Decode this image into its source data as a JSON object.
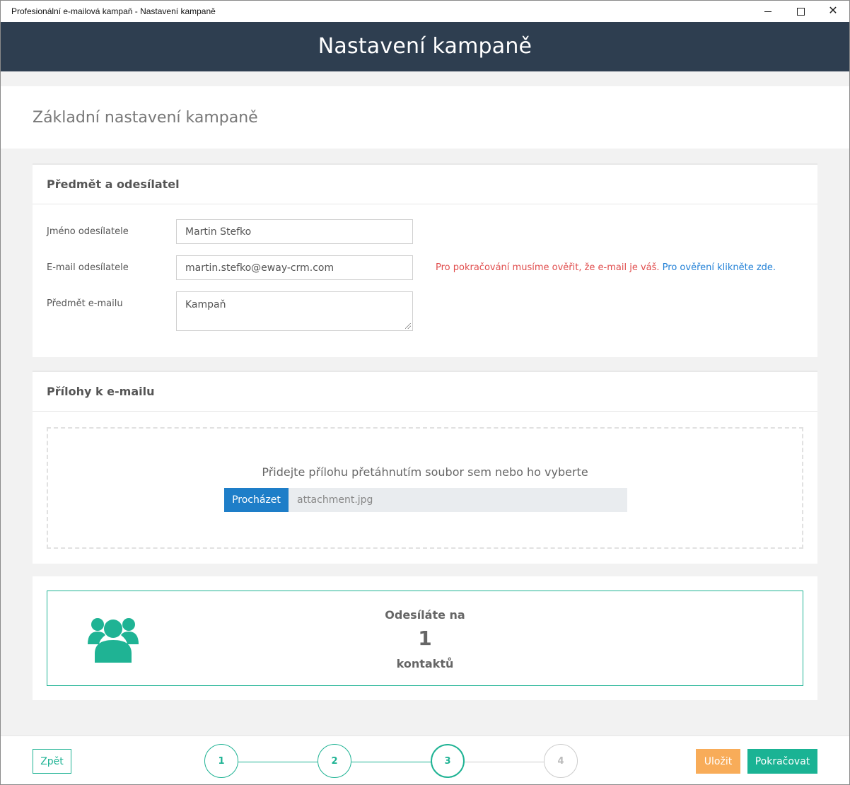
{
  "window": {
    "title": "Profesionální e-mailová kampaň - Nastavení kampaně"
  },
  "header": {
    "title": "Nastavení kampaně"
  },
  "subheader": {
    "title": "Základní nastavení kampaně"
  },
  "sender_panel": {
    "title": "Předmět a odesílatel",
    "sender_name_label": "Jméno odesílatele",
    "sender_name_value": "Martin Stefko",
    "sender_email_label": "E-mail odesílatele",
    "sender_email_value": "martin.stefko@eway-crm.com",
    "verify_warning": "Pro pokračování musíme ověřit, že e-mail je váš.",
    "verify_link": "Pro ověření klikněte zde.",
    "subject_label": "Předmět e-mailu",
    "subject_value": "Kampaň"
  },
  "attachments_panel": {
    "title": "Přílohy k e-mailu",
    "drop_text": "Přidejte přílohu přetáhnutím soubor sem nebo ho vyberte",
    "browse_label": "Procházet",
    "file_name": "attachment.jpg"
  },
  "recipients": {
    "icon": "users-icon",
    "sending_to": "Odesíláte na",
    "count": "1",
    "unit": "kontaktů"
  },
  "footer": {
    "back_label": "Zpět",
    "steps": [
      "1",
      "2",
      "3",
      "4"
    ],
    "current_step": 3,
    "save_label": "Uložit",
    "continue_label": "Pokračovat"
  },
  "colors": {
    "header_bg": "#2e3e50",
    "accent": "#1ab394",
    "warning_text": "#e04c4c",
    "link": "#1f7fd6",
    "browse_button": "#1e7ec8",
    "save_button": "#f8ac59"
  }
}
